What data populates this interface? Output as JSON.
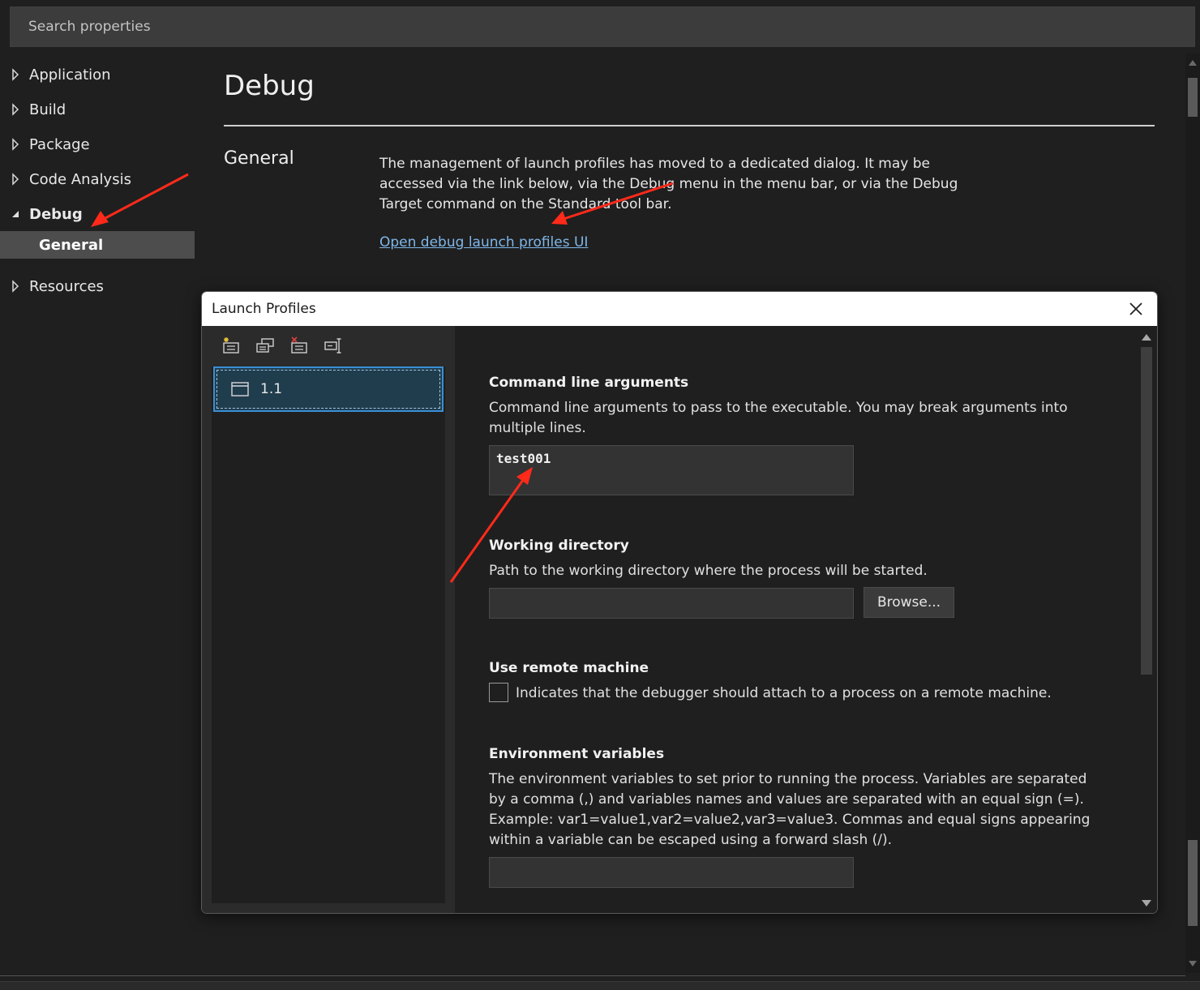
{
  "search": {
    "placeholder": "Search properties"
  },
  "nav": {
    "items": [
      {
        "label": "Application"
      },
      {
        "label": "Build"
      },
      {
        "label": "Package"
      },
      {
        "label": "Code Analysis"
      },
      {
        "label": "Debug"
      },
      {
        "label": "Resources"
      }
    ],
    "sub_item": {
      "label": "General"
    }
  },
  "page": {
    "title": "Debug",
    "section_title": "General",
    "description": "The management of launch profiles has moved to a dedicated dialog. It may be accessed via the link below, via the Debug menu in the menu bar, or via the Debug Target command on the Standard tool bar.",
    "link": "Open debug launch profiles UI"
  },
  "dialog": {
    "title": "Launch Profiles",
    "toolbar": [
      "new-profile-icon",
      "copy-profile-icon",
      "delete-profile-icon",
      "rename-profile-icon"
    ],
    "profiles": [
      {
        "label": "1.1"
      }
    ],
    "fields": {
      "args": {
        "title": "Command line arguments",
        "description": "Command line arguments to pass to the executable. You may break arguments into multiple lines.",
        "value": "test001"
      },
      "workdir": {
        "title": "Working directory",
        "description": "Path to the working directory where the process will be started.",
        "value": "",
        "browse_label": "Browse..."
      },
      "remote": {
        "title": "Use remote machine",
        "checkbox_label": "Indicates that the debugger should attach to a process on a remote machine.",
        "checked": false
      },
      "env": {
        "title": "Environment variables",
        "description": "The environment variables to set prior to running the process. Variables are separated by a comma (,) and variables names and values are separated with an equal sign (=). Example: var1=value1,var2=value2,var3=value3. Commas and equal signs appearing within a variable can be escaped using a forward slash (/).",
        "value": ""
      }
    }
  },
  "colors": {
    "background": "#1f1f1f",
    "selection": "#4d4d4d",
    "link": "#7fb7ea",
    "profile_selected": "#203d4d",
    "profile_border": "#3a8fd6",
    "annotation_arrow": "#ff2a1a"
  }
}
